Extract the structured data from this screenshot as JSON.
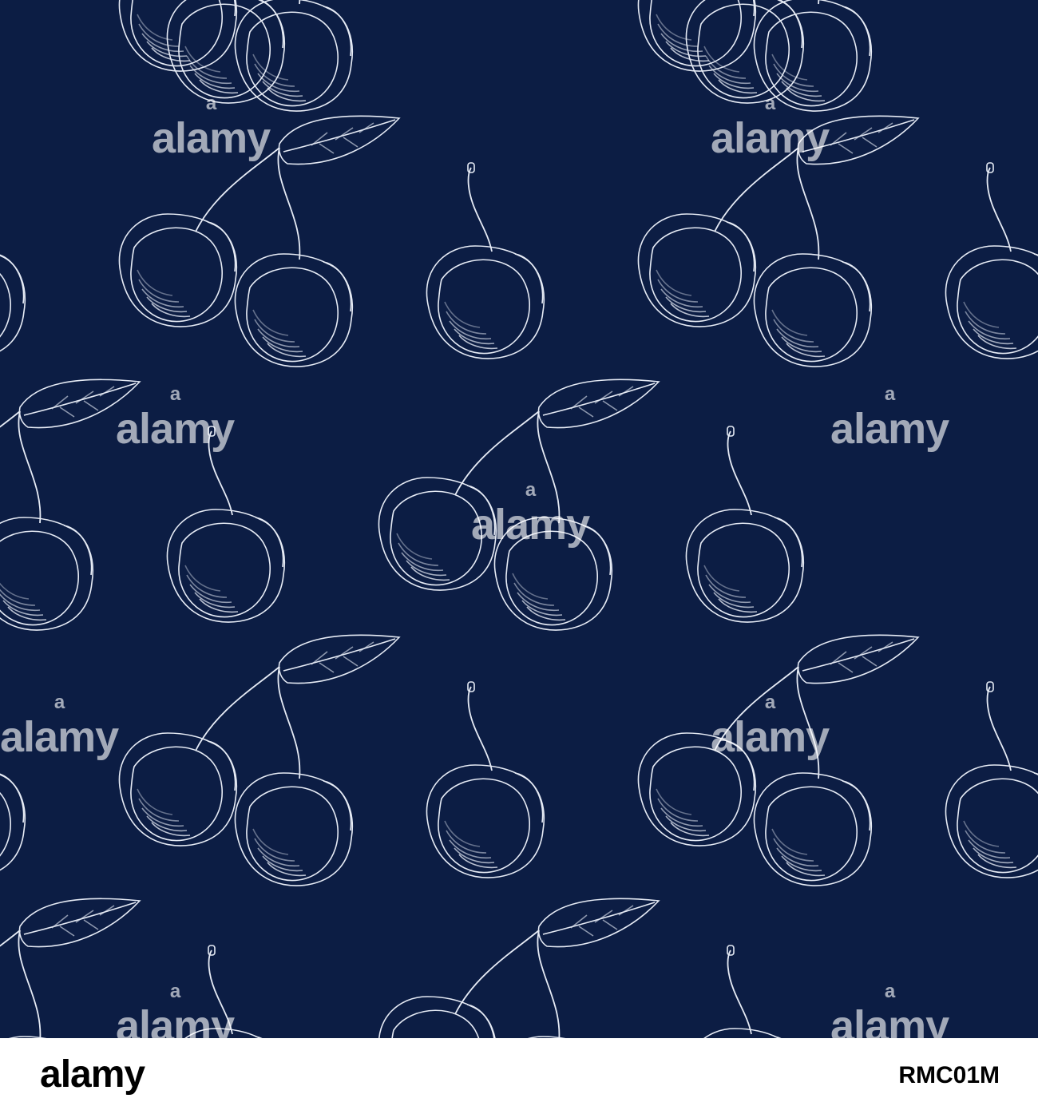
{
  "image": {
    "background_color": "#0c1d44",
    "line_color": "#e6ebf5",
    "motif": "cherry-outline-pattern"
  },
  "watermark": {
    "text": "alamy",
    "mark": "a"
  },
  "footer": {
    "logo_text": "alamy",
    "image_id": "RMC01M"
  }
}
